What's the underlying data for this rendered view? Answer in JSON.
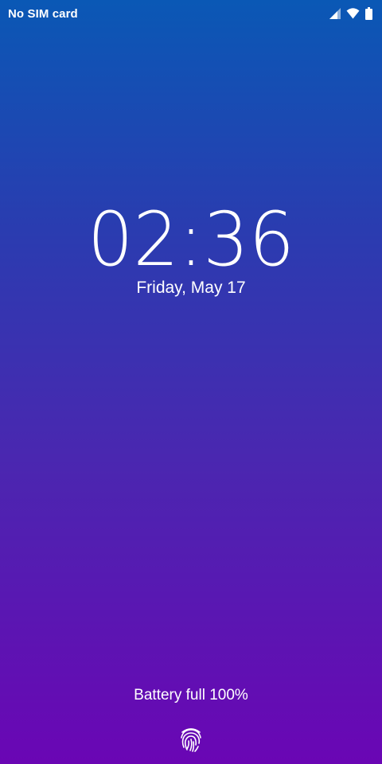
{
  "status_bar": {
    "carrier_text": "No SIM card",
    "icons": [
      "signal-icon",
      "wifi-icon",
      "battery-icon"
    ]
  },
  "lock_screen": {
    "time": "02:36",
    "date": "Friday, May 17",
    "battery_status": "Battery full 100%",
    "unlock_icon": "fingerprint-icon"
  },
  "colors": {
    "gradient_top": "#0a58b5",
    "gradient_bottom": "#6a06b4",
    "text": "#ffffff"
  }
}
